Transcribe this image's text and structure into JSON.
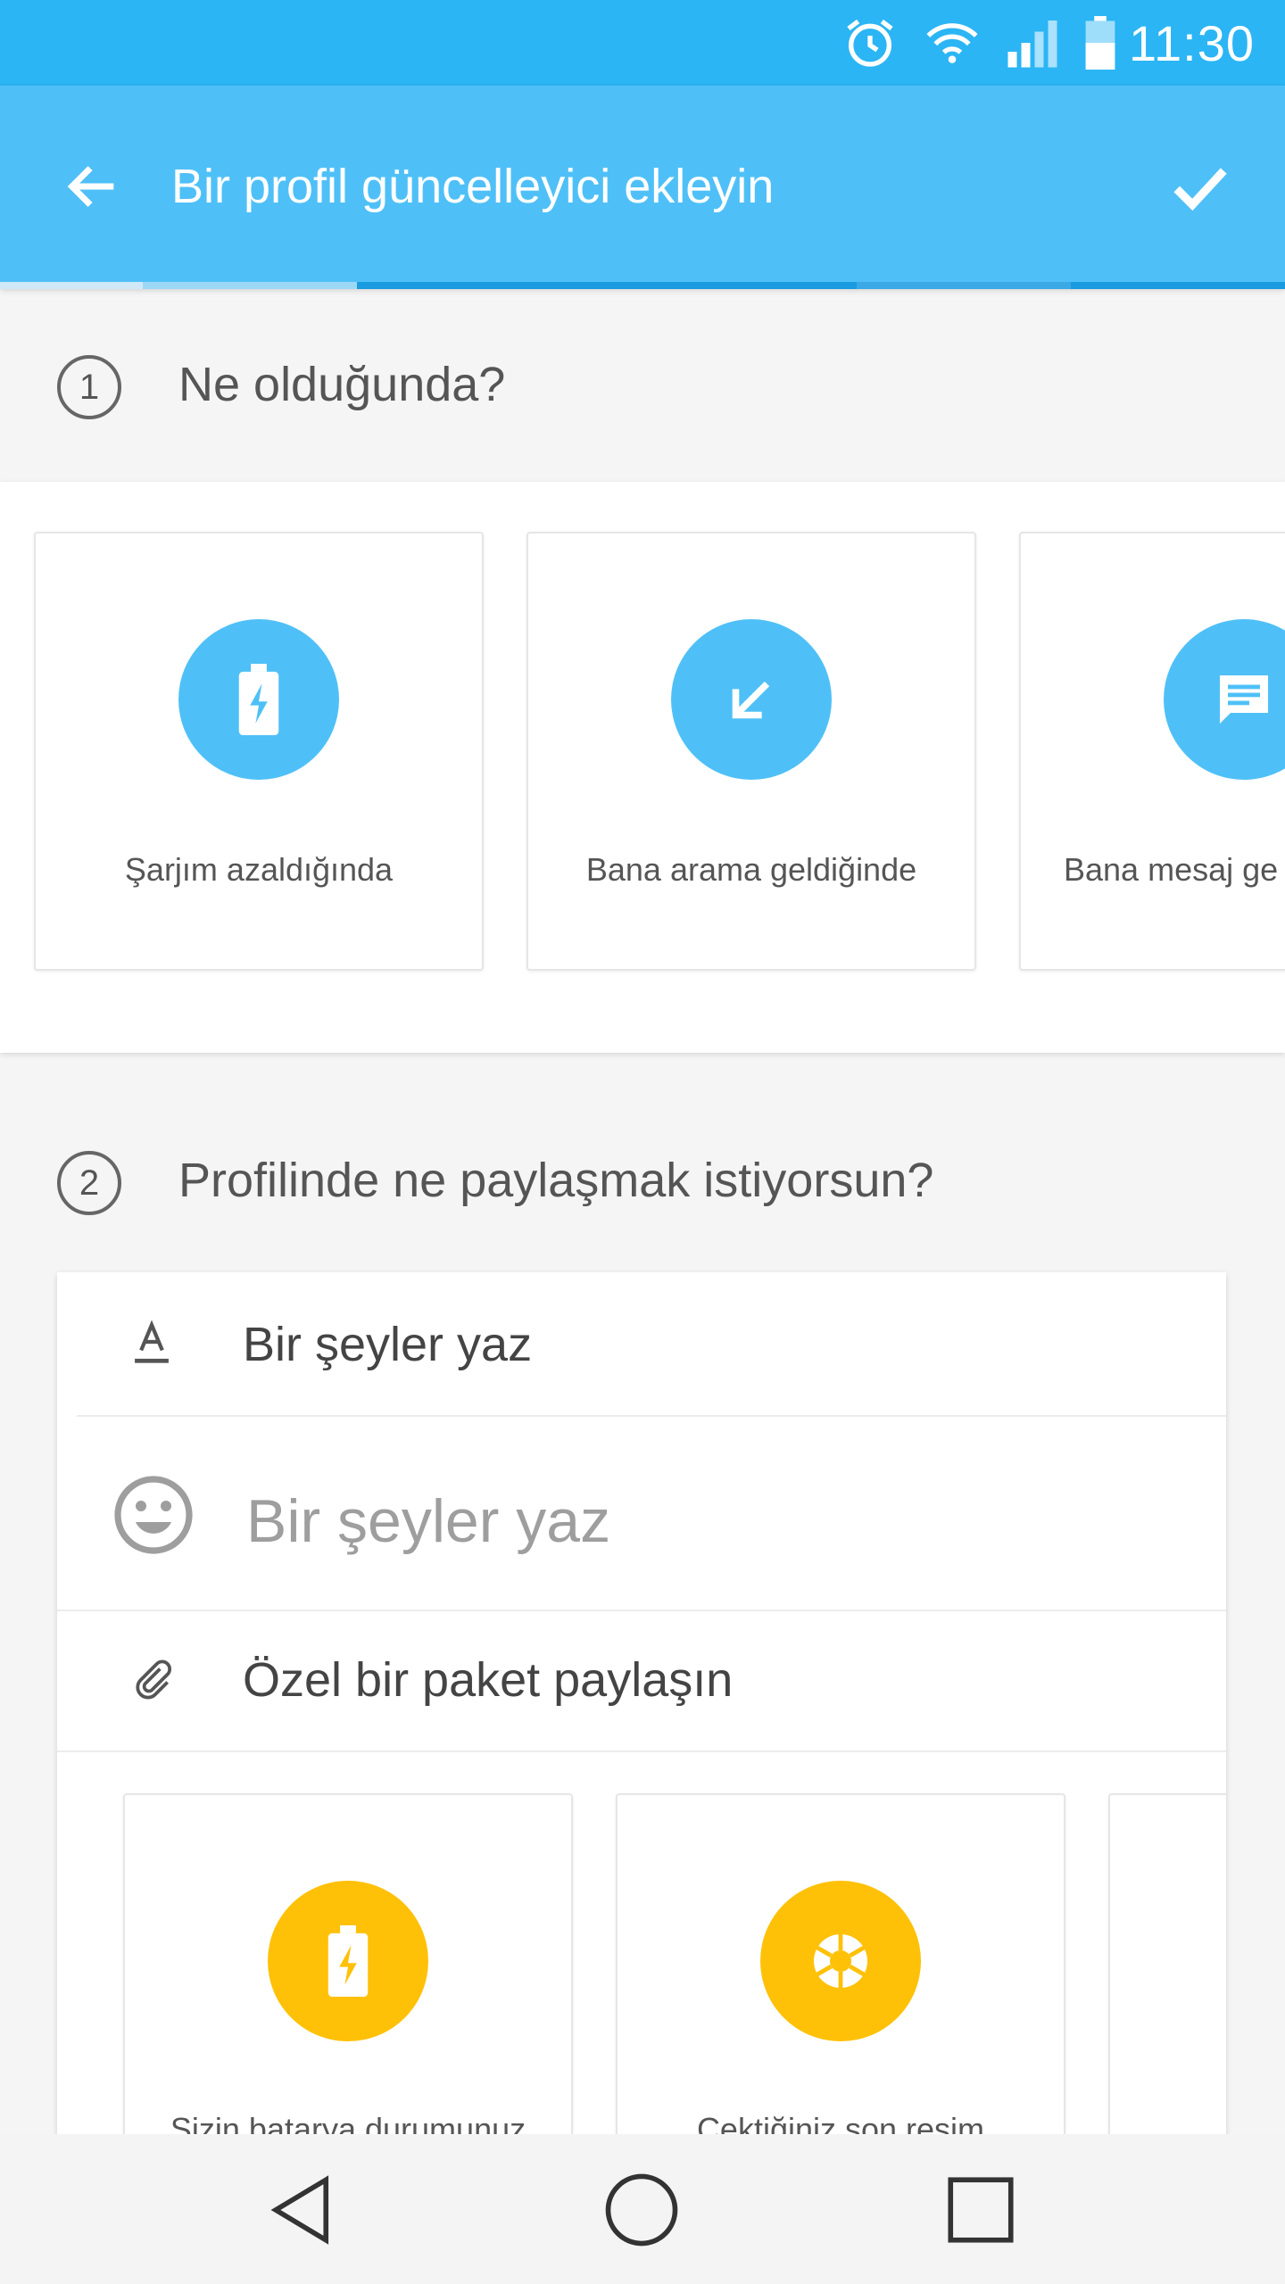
{
  "status_bar": {
    "time": "11:30",
    "icons": [
      "alarm-icon",
      "wifi-icon",
      "signal-icon",
      "battery-icon"
    ]
  },
  "app_bar": {
    "title": "Bir profil güncelleyici ekleyin",
    "back_icon": "arrow-left-icon",
    "confirm_icon": "checkmark-icon",
    "accent_color": "#4fc0f7",
    "status_color": "#2bb5f4"
  },
  "step1": {
    "number": "1",
    "title": "Ne olduğunda?",
    "triggers": [
      {
        "label": "Şarjım azaldığında",
        "icon": "battery-charging-icon",
        "color": "#4fc0f7"
      },
      {
        "label": "Bana arama geldiğinde",
        "icon": "incoming-call-arrow-icon",
        "color": "#4fc0f7"
      },
      {
        "label": "Bana mesaj ge",
        "icon": "message-icon",
        "color": "#4fc0f7"
      }
    ]
  },
  "step2": {
    "number": "2",
    "title": "Profilinde ne paylaşmak istiyorsun?",
    "write_option": "Bir şeyler yaz",
    "text_input_placeholder": "Bir şeyler yaz",
    "package_option": "Özel bir paket paylaşın",
    "packages": [
      {
        "label": "Sizin batarya durumunuz",
        "icon": "battery-charging-icon",
        "color": "#ffc107"
      },
      {
        "label": "Çektiğiniz son resim",
        "icon": "camera-shutter-icon",
        "color": "#ffc107"
      }
    ]
  },
  "nav_bar": {
    "buttons": [
      "back-triangle-icon",
      "home-circle-icon",
      "recents-square-icon"
    ]
  }
}
